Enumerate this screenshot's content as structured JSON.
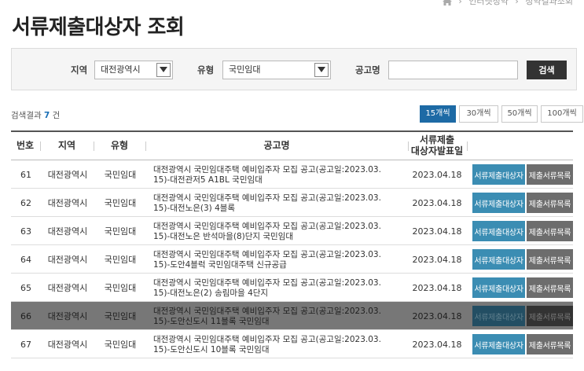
{
  "breadcrumb": {
    "items": [
      "인터넷청약",
      "청약결과조회"
    ]
  },
  "page_title": "서류제출대상자 조회",
  "search": {
    "region_label": "지역",
    "region_value": "대전광역시",
    "type_label": "유형",
    "type_value": "국민임대",
    "notice_label": "공고명",
    "notice_value": "",
    "button_label": "검색"
  },
  "result": {
    "prefix": "검색결과",
    "count": "7",
    "suffix": "건"
  },
  "page_size": [
    "15개씩",
    "30개씩",
    "50개씩",
    "100개씩"
  ],
  "page_size_active": "15개씩",
  "table": {
    "headers": {
      "no": "번호",
      "region": "지역",
      "type": "유형",
      "title": "공고명",
      "date_line1": "서류제출",
      "date_line2": "대상자발표일"
    },
    "rows": [
      {
        "no": "61",
        "region": "대전광역시",
        "type": "국민임대",
        "title_line1": "대전광역시 국민임대주택 예비입주자 모집 공고(공고일:2023.03.",
        "title_line2": "15)-대전관저5 A1BL 국민임대",
        "date": "2023.04.18",
        "btn1": "서류제출대상자",
        "btn2": "제출서류목록"
      },
      {
        "no": "62",
        "region": "대전광역시",
        "type": "국민임대",
        "title_line1": "대전광역시 국민임대주택 예비입주자 모집 공고(공고일:2023.03.",
        "title_line2": "15)-대전노은(3) 4블록",
        "date": "2023.04.18",
        "btn1": "서류제출대상자",
        "btn2": "제출서류목록"
      },
      {
        "no": "63",
        "region": "대전광역시",
        "type": "국민임대",
        "title_line1": "대전광역시 국민임대주택 예비입주자 모집 공고(공고일:2023.03.",
        "title_line2": "15)-대전노은 반석마을(8)단지 국민임대",
        "date": "2023.04.18",
        "btn1": "서류제출대상자",
        "btn2": "제출서류목록"
      },
      {
        "no": "64",
        "region": "대전광역시",
        "type": "국민임대",
        "title_line1": "대전광역시 국민임대주택 예비입주자 모집 공고(공고일:2023.03.",
        "title_line2": "15)-도안4블럭 국민임대주택 신규공급",
        "date": "2023.04.18",
        "btn1": "서류제출대상자",
        "btn2": "제출서류목록"
      },
      {
        "no": "65",
        "region": "대전광역시",
        "type": "국민임대",
        "title_line1": "대전광역시 국민임대주택 예비입주자 모집 공고(공고일:2023.03.",
        "title_line2": "15)-대전노은(2) 송림마을 4단지",
        "date": "2023.04.18",
        "btn1": "서류제출대상자",
        "btn2": "제출서류목록"
      },
      {
        "no": "66",
        "region": "대전광역시",
        "type": "국민임대",
        "title_line1": "대전광역시 국민임대주택 예비입주자 모집 공고(공고일:2023.03.",
        "title_line2": "15)-도안신도시 11블록 국민임대",
        "date": "2023.04.18",
        "btn1": "서류제출대상자",
        "btn2": "제출서류목록"
      },
      {
        "no": "67",
        "region": "대전광역시",
        "type": "국민임대",
        "title_line1": "대전광역시 국민임대주택 예비입주자 모집 공고(공고일:2023.03.",
        "title_line2": "15)-도안신도시 10블록 국민임대",
        "date": "2023.04.18",
        "btn1": "서류제출대상자",
        "btn2": "제출서류목록"
      }
    ]
  },
  "colors": {
    "accent_blue": "#1d6aa5",
    "button_blue": "#3b8db3",
    "button_gray": "#6d6d6d",
    "count_blue": "#1a6fb5"
  },
  "icons": {
    "home": "home-icon",
    "separator": "chevron-right-icon",
    "select_arrow": "chevron-down-icon"
  }
}
